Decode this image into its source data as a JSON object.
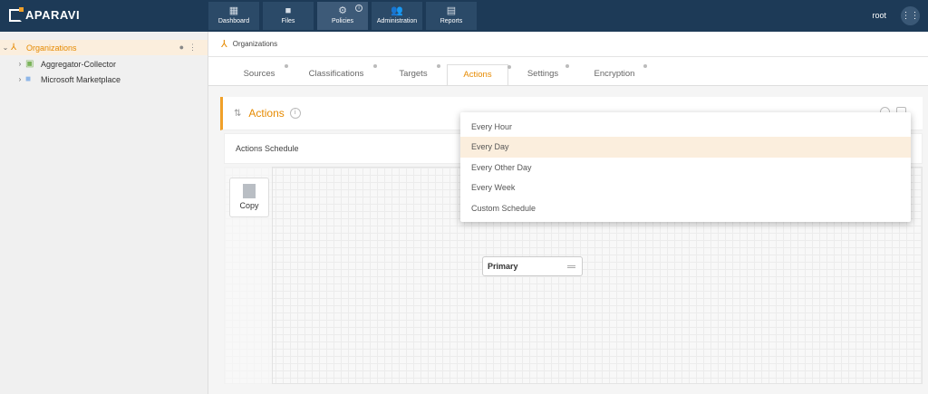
{
  "brand": {
    "name": "APARAVI"
  },
  "nav": {
    "items": [
      {
        "label": "Dashboard",
        "icon": "dashboard-icon"
      },
      {
        "label": "Files",
        "icon": "folder-icon"
      },
      {
        "label": "Policies",
        "icon": "gear-icon"
      },
      {
        "label": "Administration",
        "icon": "users-icon"
      },
      {
        "label": "Reports",
        "icon": "report-icon"
      }
    ],
    "active": "Policies"
  },
  "user": {
    "name": "root"
  },
  "sidebar": {
    "items": [
      {
        "label": "Organizations",
        "selected": true,
        "icon": "organization-icon"
      },
      {
        "label": "Aggregator-Collector",
        "icon": "server-icon"
      },
      {
        "label": "Microsoft Marketplace",
        "icon": "folder-icon"
      }
    ]
  },
  "breadcrumb": {
    "label": "Organizations"
  },
  "tabs": [
    {
      "label": "Sources"
    },
    {
      "label": "Classifications"
    },
    {
      "label": "Targets"
    },
    {
      "label": "Actions",
      "active": true
    },
    {
      "label": "Settings"
    },
    {
      "label": "Encryption"
    }
  ],
  "panel": {
    "title": "Actions",
    "schedule_label": "Actions Schedule"
  },
  "palette": {
    "copy_label": "Copy"
  },
  "canvas": {
    "node_label": "Primary"
  },
  "schedule_dropdown": {
    "options": [
      "Every Hour",
      "Every Day",
      "Every Other Day",
      "Every Week",
      "Custom Schedule"
    ],
    "selected": "Every Day"
  },
  "colors": {
    "header": "#1d3a57",
    "accent": "#e68a00",
    "selected_bg": "#fbeedd"
  }
}
